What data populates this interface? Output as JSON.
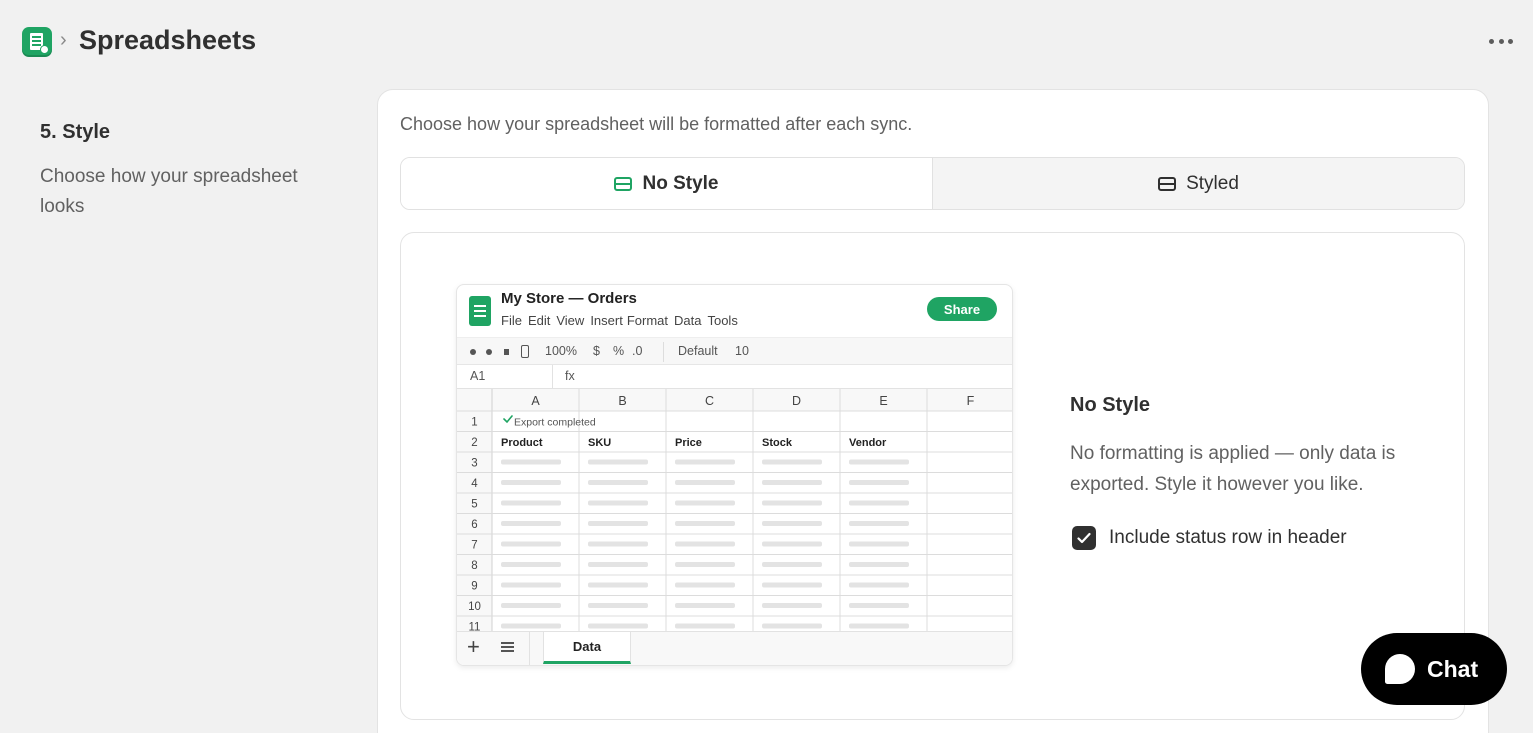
{
  "header": {
    "app_icon": "google-sheets-icon",
    "breadcrumb_separator": "›",
    "title": "Spreadsheets",
    "more_icon": "ellipsis-icon"
  },
  "section": {
    "title": "5. Style",
    "description": "Choose how your spreadsheet looks"
  },
  "card": {
    "intro": "Choose how your spreadsheet will be formatted after each sync.",
    "options": [
      {
        "label": "No Style",
        "icon": "layout-icon",
        "selected": true
      },
      {
        "label": "Styled",
        "icon": "layout-icon",
        "selected": false
      }
    ]
  },
  "preview": {
    "doc_title": "My Store — Orders",
    "menu": [
      "File",
      "Edit",
      "View",
      "Insert",
      "Format",
      "Data",
      "Tools"
    ],
    "share_label": "Share",
    "toolbar": {
      "zoom": "100%",
      "currency": "$",
      "percent": "%",
      "decimal": ".0",
      "font": "Default",
      "font_size": "10"
    },
    "cell_ref": "A1",
    "fx_label": "fx",
    "columns": [
      "A",
      "B",
      "C",
      "D",
      "E",
      "F"
    ],
    "rows": [
      "1",
      "2",
      "3",
      "4",
      "5",
      "6",
      "7",
      "8",
      "9",
      "10",
      "11"
    ],
    "status_text": "Export completed",
    "headers": [
      "Product",
      "SKU",
      "Price",
      "Stock",
      "Vendor"
    ],
    "sheet_tab": "Data",
    "accent": "#1fa463"
  },
  "detail": {
    "title": "No Style",
    "description": "No formatting is applied — only data is exported. Style it however you like.",
    "checkbox_label": "Include status row in header",
    "checkbox_checked": true
  },
  "chat": {
    "label": "Chat",
    "icon": "chat-bubble-icon"
  }
}
